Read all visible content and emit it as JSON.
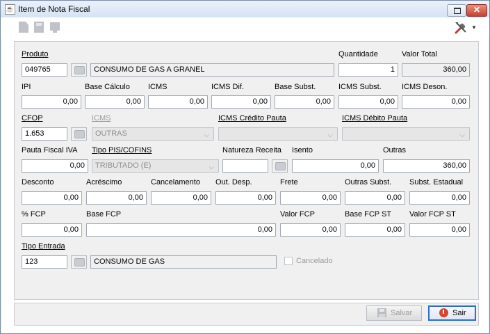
{
  "window": {
    "title": "Item de Nota Fiscal",
    "close_glyph": "✕"
  },
  "icons": {
    "app": "java-icon",
    "new": "new-document-icon",
    "save": "save-disk-icon",
    "screen": "monitor-icon",
    "tools": "tools-icon",
    "lookup": "magnifier-icon",
    "caret": "chevron-down-icon"
  },
  "colors": {
    "close_button": "#c7432e",
    "focus_border": "#2b6fc8",
    "panel_bg": "#f0f0f0"
  },
  "produto": {
    "label": "Produto",
    "code": "049765",
    "description": "CONSUMO DE GAS A GRANEL"
  },
  "quantidade": {
    "label": "Quantidade",
    "value": "1"
  },
  "valor_total": {
    "label": "Valor Total",
    "value": "360,00"
  },
  "row2": [
    {
      "label": "IPI",
      "value": "0,00"
    },
    {
      "label": "Base Cálculo",
      "value": "0,00"
    },
    {
      "label": "ICMS",
      "value": "0,00"
    },
    {
      "label": "ICMS Dif.",
      "value": "0,00"
    },
    {
      "label": "Base Subst.",
      "value": "0,00"
    },
    {
      "label": "ICMS Subst.",
      "value": "0,00"
    },
    {
      "label": "ICMS Deson.",
      "value": "0,00"
    }
  ],
  "cfop": {
    "label": "CFOP",
    "value": "1.653"
  },
  "icms_combo": {
    "label": "ICMS",
    "value": "OUTRAS"
  },
  "icms_credito_pauta": {
    "label": "ICMS Crédito Pauta",
    "value": ""
  },
  "icms_debito_pauta": {
    "label": "ICMS Débito Pauta",
    "value": ""
  },
  "pauta_fiscal_iva": {
    "label": "Pauta Fiscal IVA",
    "value": "0,00"
  },
  "tipo_pis_cofins": {
    "label": "Tipo PIS/COFINS",
    "value": "TRIBUTADO (E)"
  },
  "natureza_receita": {
    "label": "Natureza Receita",
    "value": ""
  },
  "isento": {
    "label": "Isento",
    "value": "0,00"
  },
  "outras": {
    "label": "Outras",
    "value": "360,00"
  },
  "row5": [
    {
      "label": "Desconto",
      "value": "0,00"
    },
    {
      "label": "Acréscimo",
      "value": "0,00"
    },
    {
      "label": "Cancelamento",
      "value": "0,00"
    },
    {
      "label": "Out. Desp.",
      "value": "0,00"
    },
    {
      "label": "Frete",
      "value": "0,00"
    },
    {
      "label": "Outras Subst.",
      "value": "0,00"
    },
    {
      "label": "Subst. Estadual",
      "value": "0,00"
    }
  ],
  "fcp": {
    "label": "% FCP",
    "value": "0,00"
  },
  "base_fcp": {
    "label": "Base FCP",
    "value": "0,00"
  },
  "valor_fcp": {
    "label": "Valor FCP",
    "value": "0,00"
  },
  "base_fcp_st": {
    "label": "Base FCP ST",
    "value": "0,00"
  },
  "valor_fcp_st": {
    "label": "Valor FCP ST",
    "value": "0,00"
  },
  "tipo_entrada": {
    "label": "Tipo Entrada",
    "code": "123",
    "description": "CONSUMO DE GAS"
  },
  "cancelado": {
    "label": "Cancelado",
    "checked": false
  },
  "buttons": {
    "salvar": "Salvar",
    "sair": "Sair"
  }
}
